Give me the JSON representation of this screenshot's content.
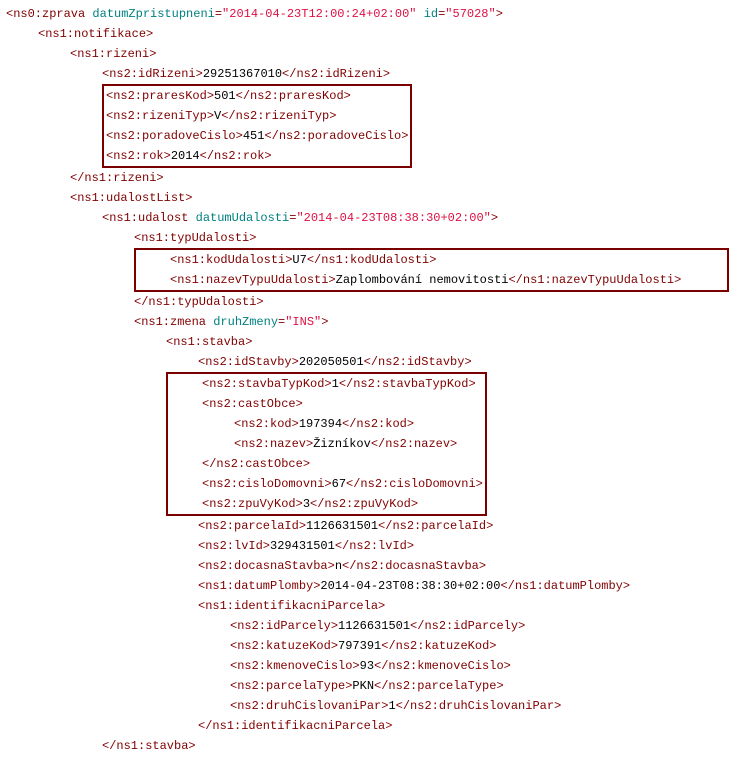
{
  "l1": {
    "t1": "<ns0:zprava ",
    "an1": "datumZpristupneni",
    "av1": "\"2014-04-23T12:00:24+02:00\"",
    "an2": "id",
    "av2": "\"57028\"",
    "t2": ">"
  },
  "l2": {
    "t": "<ns1:notifikace>"
  },
  "l3": {
    "t": "<ns1:rizeni>"
  },
  "l4": {
    "o": "<ns2:idRizeni>",
    "v": "29251367010",
    "c": "</ns2:idRizeni>"
  },
  "l5": {
    "o": "<ns2:praresKod>",
    "v": "501",
    "c": "</ns2:praresKod>"
  },
  "l6": {
    "o": "<ns2:rizeniTyp>",
    "v": "V",
    "c": "</ns2:rizeniTyp>"
  },
  "l7": {
    "o": "<ns2:poradoveCislo>",
    "v": "451",
    "c": "</ns2:poradoveCislo>"
  },
  "l8": {
    "o": "<ns2:rok>",
    "v": "2014",
    "c": "</ns2:rok>"
  },
  "l9": {
    "t": "</ns1:rizeni>"
  },
  "l10": {
    "t": "<ns1:udalostList>"
  },
  "l11": {
    "t1": "<ns1:udalost ",
    "an1": "datumUdalosti",
    "av1": "\"2014-04-23T08:38:30+02:00\"",
    "t2": ">"
  },
  "l12": {
    "t": "<ns1:typUdalosti>"
  },
  "l13": {
    "o": "<ns1:kodUdalosti>",
    "v": "U7",
    "c": "</ns1:kodUdalosti>"
  },
  "l14": {
    "o": "<ns1:nazevTypuUdalosti>",
    "v": "Zaplombování nemovitosti",
    "c": "</ns1:nazevTypuUdalosti>"
  },
  "l15": {
    "t": "</ns1:typUdalosti>"
  },
  "l16": {
    "t1": "<ns1:zmena ",
    "an1": "druhZmeny",
    "av1": "\"INS\"",
    "t2": ">"
  },
  "l17": {
    "t": "<ns1:stavba>"
  },
  "l18": {
    "o": "<ns2:idStavby>",
    "v": "202050501",
    "c": "</ns2:idStavby>"
  },
  "l19": {
    "o": "<ns2:stavbaTypKod>",
    "v": "1",
    "c": "</ns2:stavbaTypKod>"
  },
  "l20": {
    "t": "<ns2:castObce>"
  },
  "l21": {
    "o": "<ns2:kod>",
    "v": "197394",
    "c": "</ns2:kod>"
  },
  "l22": {
    "o": "<ns2:nazev>",
    "v": "Žizníkov",
    "c": "</ns2:nazev>"
  },
  "l23": {
    "t": "</ns2:castObce>"
  },
  "l24": {
    "o": "<ns2:cisloDomovni>",
    "v": "67",
    "c": "</ns2:cisloDomovni>"
  },
  "l25": {
    "o": "<ns2:zpuVyKod>",
    "v": "3",
    "c": "</ns2:zpuVyKod>"
  },
  "l26": {
    "o": "<ns2:parcelaId>",
    "v": "1126631501",
    "c": "</ns2:parcelaId>"
  },
  "l27": {
    "o": "<ns2:lvId>",
    "v": "329431501",
    "c": "</ns2:lvId>"
  },
  "l28": {
    "o": "<ns2:docasnaStavba>",
    "v": "n",
    "c": "</ns2:docasnaStavba>"
  },
  "l29": {
    "o": "<ns1:datumPlomby>",
    "v": "2014-04-23T08:38:30+02:00",
    "c": "</ns1:datumPlomby>"
  },
  "l30": {
    "t": "<ns1:identifikacniParcela>"
  },
  "l31": {
    "o": "<ns2:idParcely>",
    "v": "1126631501",
    "c": "</ns2:idParcely>"
  },
  "l32": {
    "o": "<ns2:katuzeKod>",
    "v": "797391",
    "c": "</ns2:katuzeKod>"
  },
  "l33": {
    "o": "<ns2:kmenoveCislo>",
    "v": "93",
    "c": "</ns2:kmenoveCislo>"
  },
  "l34": {
    "o": "<ns2:parcelaType>",
    "v": "PKN",
    "c": "</ns2:parcelaType>"
  },
  "l35": {
    "o": "<ns2:druhCislovaniPar>",
    "v": "1",
    "c": "</ns2:druhCislovaniPar>"
  },
  "l36": {
    "t": "</ns1:identifikacniParcela>"
  },
  "l37a": {
    "t": "</ns1:stavba>"
  },
  "l37b": {
    "t": " "
  }
}
